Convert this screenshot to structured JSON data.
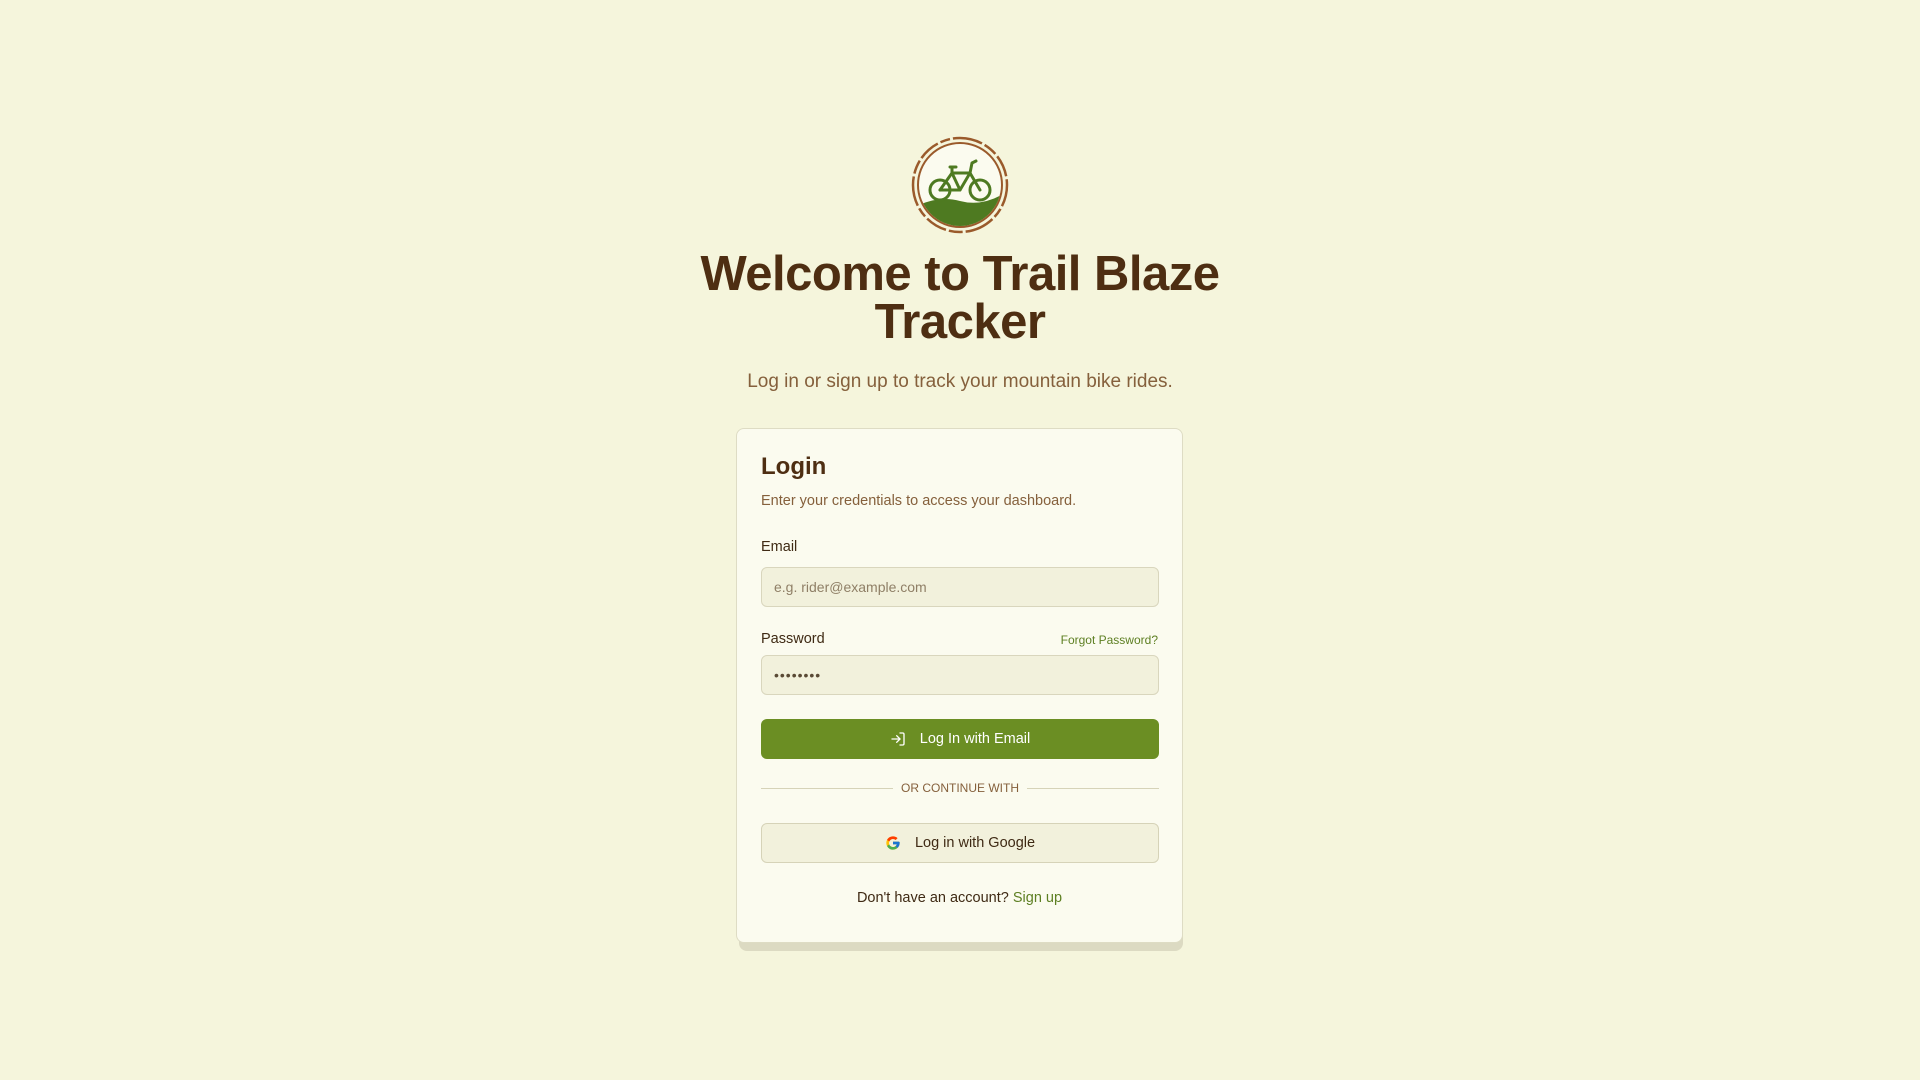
{
  "app": {
    "logo_icon": "mountain-bike-logo-icon",
    "heading": "Welcome to Trail Blaze Tracker",
    "subheading": "Log in or sign up to track your mountain bike rides."
  },
  "login": {
    "title": "Login",
    "description": "Enter your credentials to access your dashboard.",
    "email_label": "Email",
    "email_placeholder": "e.g. rider@example.com",
    "email_value": "",
    "password_label": "Password",
    "forgot_password": "Forgot Password?",
    "password_value": "••••••••",
    "login_button": "Log In with Email",
    "login_icon": "log-in-icon",
    "divider_text": "OR CONTINUE WITH",
    "google_button": "Log in with Google",
    "google_icon": "google-icon",
    "signup_prompt": "Don't have an account?",
    "signup_link": "Sign up"
  },
  "colors": {
    "background": "#f5f5dc",
    "primary": "#6b8e23",
    "heading": "#4e2e12",
    "muted_text": "#85603c",
    "link": "#5d7f22"
  }
}
